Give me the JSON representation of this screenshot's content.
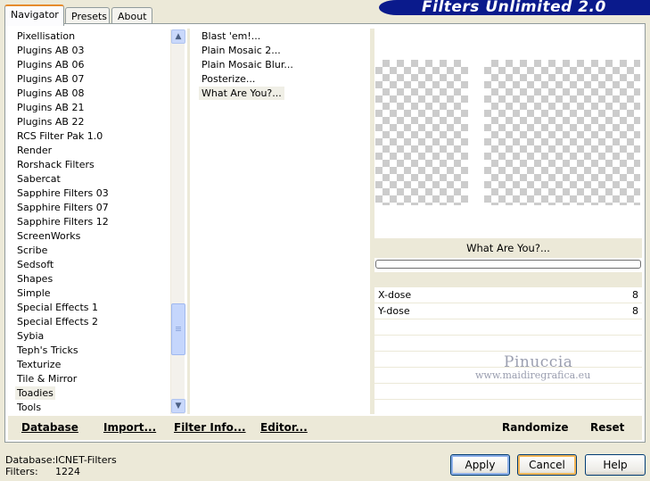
{
  "tabs": [
    {
      "label": "Navigator",
      "active": true
    },
    {
      "label": "Presets",
      "active": false
    },
    {
      "label": "About",
      "active": false
    }
  ],
  "banner": {
    "title": "Filters Unlimited 2.0"
  },
  "categories": [
    {
      "label": "Pixellisation"
    },
    {
      "label": "Plugins AB 03"
    },
    {
      "label": "Plugins AB 06"
    },
    {
      "label": "Plugins AB 07"
    },
    {
      "label": "Plugins AB 08"
    },
    {
      "label": "Plugins AB 21"
    },
    {
      "label": "Plugins AB 22"
    },
    {
      "label": "RCS Filter Pak 1.0"
    },
    {
      "label": "Render"
    },
    {
      "label": "Rorshack Filters"
    },
    {
      "label": "Sabercat"
    },
    {
      "label": "Sapphire Filters 03"
    },
    {
      "label": "Sapphire Filters 07"
    },
    {
      "label": "Sapphire Filters 12"
    },
    {
      "label": "ScreenWorks"
    },
    {
      "label": "Scribe"
    },
    {
      "label": "Sedsoft"
    },
    {
      "label": "Shapes"
    },
    {
      "label": "Simple"
    },
    {
      "label": "Special Effects 1"
    },
    {
      "label": "Special Effects 2"
    },
    {
      "label": "Sybia"
    },
    {
      "label": "Teph's Tricks"
    },
    {
      "label": "Texturize"
    },
    {
      "label": "Tile & Mirror"
    },
    {
      "label": "Toadies",
      "selected": true
    },
    {
      "label": "Tools"
    }
  ],
  "filters": [
    {
      "label": "Blast 'em!..."
    },
    {
      "label": "Plain Mosaic 2..."
    },
    {
      "label": "Plain Mosaic Blur..."
    },
    {
      "label": "Posterize..."
    },
    {
      "label": "What Are You?...",
      "selected": true
    }
  ],
  "preview": {
    "filter_name": "What Are You?..."
  },
  "params": [
    {
      "name": "X-dose",
      "value": "8"
    },
    {
      "name": "Y-dose",
      "value": "8"
    }
  ],
  "watermark": {
    "line1": "Pinuccia",
    "line2": "www.maidiregrafica.eu"
  },
  "toolbar": {
    "database": "Database",
    "import": "Import...",
    "filter_info": "Filter Info...",
    "editor": "Editor...",
    "randomize": "Randomize",
    "reset": "Reset"
  },
  "info": {
    "database_label": "Database:",
    "database_value": "ICNET-Filters",
    "filters_label": "Filters:",
    "filters_value": "1224"
  },
  "buttons": {
    "apply": "Apply",
    "cancel": "Cancel",
    "help": "Help"
  },
  "icons": {
    "scroll_up": "chevron-up-icon",
    "scroll_down": "chevron-down-icon"
  }
}
